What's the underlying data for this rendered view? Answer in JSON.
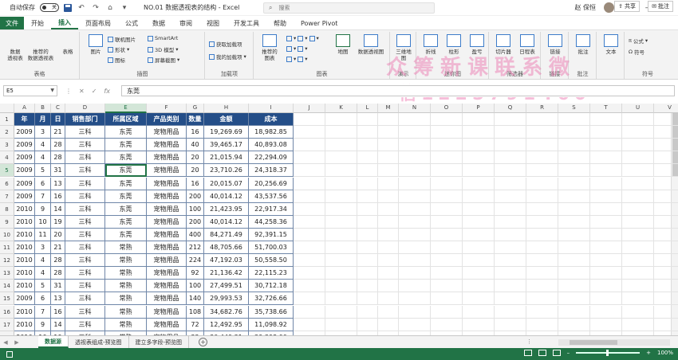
{
  "titlebar": {
    "autosave_label": "自动保存",
    "autosave_state": "关",
    "title": "NO.01 数据透视表的结构 - Excel",
    "search_placeholder": "搜索",
    "user_name": "赵 保恒"
  },
  "tabs": [
    {
      "label": "文件",
      "active": false,
      "file": true
    },
    {
      "label": "开始",
      "active": false
    },
    {
      "label": "插入",
      "active": true
    },
    {
      "label": "页面布局",
      "active": false
    },
    {
      "label": "公式",
      "active": false
    },
    {
      "label": "数据",
      "active": false
    },
    {
      "label": "审阅",
      "active": false
    },
    {
      "label": "视图",
      "active": false
    },
    {
      "label": "开发工具",
      "active": false
    },
    {
      "label": "帮助",
      "active": false
    },
    {
      "label": "Power Pivot",
      "active": false
    }
  ],
  "share_label": "共享",
  "comment_label": "批注",
  "ribbon": {
    "pivot_btn": "数据\n透视表",
    "rec_pivot_btn": "推荐的\n数据透视表",
    "table_btn": "表格",
    "group_tables": "表格",
    "picture_btn": "图片",
    "online_pic": "联机图片",
    "shapes": "形状",
    "icons": "图标",
    "smartart": "SmartArt",
    "model3d": "3D 模型",
    "screenshot": "屏幕截图",
    "group_illust": "插图",
    "get_addins": "获取加载项",
    "my_addins": "我的加载项",
    "group_addins": "加载项",
    "rec_charts": "推荐的\n图表",
    "group_charts": "图表",
    "maps": "地图",
    "pivot_chart": "数据透视图",
    "three_d": "三维地\n图",
    "group_demo": "演示",
    "line": "折线",
    "column": "柱形",
    "winloss": "盈亏",
    "group_spark": "迷你图",
    "slicer": "切片器",
    "timeline": "日程表",
    "group_filter": "筛选器",
    "link": "链接",
    "group_link": "链接",
    "comment": "批注",
    "group_comment": "批注",
    "text": "文本",
    "formula": "公式",
    "symbol": "符号",
    "group_symbol": "符号"
  },
  "formula_bar": {
    "cell_ref": "E5",
    "content": "东莞",
    "fx": "fx"
  },
  "grid": {
    "columns": [
      "A",
      "B",
      "C",
      "D",
      "E",
      "F",
      "G",
      "H",
      "I",
      "J",
      "K",
      "L",
      "M",
      "N",
      "O",
      "P",
      "Q",
      "R",
      "S",
      "T",
      "U",
      "V"
    ],
    "headers": [
      "年",
      "月",
      "日",
      "销售部门",
      "所属区域",
      "产品类别",
      "数量",
      "金额",
      "成本"
    ],
    "rows": [
      [
        "2009",
        "3",
        "21",
        "三科",
        "东莞",
        "宠物用品",
        "16",
        "19,269.69",
        "18,982.85"
      ],
      [
        "2009",
        "4",
        "28",
        "三科",
        "东莞",
        "宠物用品",
        "40",
        "39,465.17",
        "40,893.08"
      ],
      [
        "2009",
        "4",
        "28",
        "三科",
        "东莞",
        "宠物用品",
        "20",
        "21,015.94",
        "22,294.09"
      ],
      [
        "2009",
        "5",
        "31",
        "三科",
        "东莞",
        "宠物用品",
        "20",
        "23,710.26",
        "24,318.37"
      ],
      [
        "2009",
        "6",
        "13",
        "三科",
        "东莞",
        "宠物用品",
        "16",
        "20,015.07",
        "20,256.69"
      ],
      [
        "2009",
        "7",
        "16",
        "三科",
        "东莞",
        "宠物用品",
        "200",
        "40,014.12",
        "43,537.56"
      ],
      [
        "2010",
        "9",
        "14",
        "三科",
        "东莞",
        "宠物用品",
        "100",
        "21,423.95",
        "22,917.34"
      ],
      [
        "2010",
        "10",
        "19",
        "三科",
        "东莞",
        "宠物用品",
        "200",
        "40,014.12",
        "44,258.36"
      ],
      [
        "2010",
        "11",
        "20",
        "三科",
        "东莞",
        "宠物用品",
        "400",
        "84,271.49",
        "92,391.15"
      ],
      [
        "2010",
        "3",
        "21",
        "三科",
        "常熟",
        "宠物用品",
        "212",
        "48,705.66",
        "51,700.03"
      ],
      [
        "2010",
        "4",
        "28",
        "三科",
        "常熟",
        "宠物用品",
        "224",
        "47,192.03",
        "50,558.50"
      ],
      [
        "2010",
        "4",
        "28",
        "三科",
        "常熟",
        "宠物用品",
        "92",
        "21,136.42",
        "22,115.23"
      ],
      [
        "2010",
        "5",
        "31",
        "三科",
        "常熟",
        "宠物用品",
        "100",
        "27,499.51",
        "30,712.18"
      ],
      [
        "2009",
        "6",
        "13",
        "三科",
        "常熟",
        "宠物用品",
        "140",
        "29,993.53",
        "32,726.66"
      ],
      [
        "2010",
        "7",
        "16",
        "三科",
        "常熟",
        "宠物用品",
        "108",
        "34,682.76",
        "35,738.66"
      ],
      [
        "2010",
        "9",
        "14",
        "三科",
        "常熟",
        "宠物用品",
        "72",
        "12,492.95",
        "11,098.92"
      ],
      [
        "2010",
        "10",
        "19",
        "三科",
        "常熟",
        "宠物用品",
        "32",
        "30,449.31",
        "29,398.00"
      ],
      [
        "2009",
        "11",
        "20",
        "三科",
        "常熟",
        "宠物用品",
        "12",
        "12,125.30",
        "11,641.51"
      ]
    ],
    "selected_row": 5,
    "selected_col": "E"
  },
  "sheets": [
    {
      "label": "数据源",
      "active": true
    },
    {
      "label": "透视表组成-预览图",
      "active": false
    },
    {
      "label": "建立多字段-预览图",
      "active": false
    }
  ],
  "status": {
    "zoom": "100%"
  },
  "watermark": {
    "line1": "众筹新课联系微",
    "line2": "信1225791460"
  }
}
